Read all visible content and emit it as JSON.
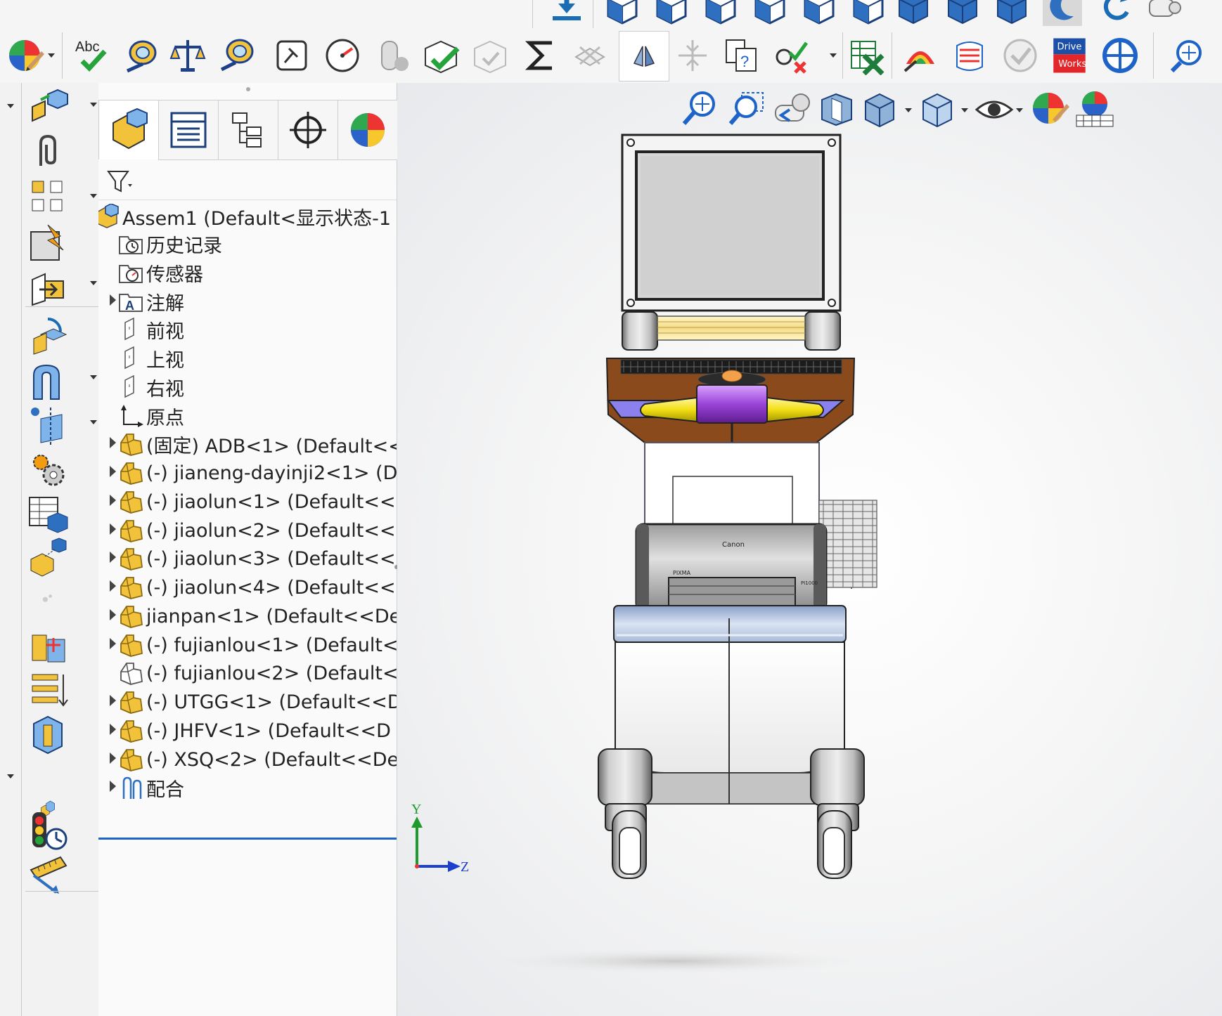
{
  "top_strip": {
    "icons": [
      "insert-component-icon",
      "box-view-icon-1",
      "box-view-icon-2",
      "box-view-icon-3",
      "box-view-icon-4",
      "box-view-icon-5",
      "box-view-icon-6",
      "cube-view-icon-1",
      "cube-view-icon-2",
      "cube-view-icon-3",
      "moon-icon",
      "rotate-icon",
      "camera-icon"
    ]
  },
  "command_bar": {
    "appearance_icon": "appearance-ball-icon",
    "spell_check_label": "Abc",
    "drive_works_line1": "Drive",
    "drive_works_line2": "Works",
    "icons": [
      "spell-check-icon",
      "measure-icon",
      "mass-properties-icon",
      "section-properties-icon",
      "sensor-icon",
      "performance-icon",
      "interference-icon",
      "check-icon",
      "sum-icon",
      "hole-alignment-icon",
      "symmetry-icon",
      "compare-icon",
      "compare-docs-icon",
      "check-errors-icon",
      "excel-x-icon",
      "curvature-icon",
      "zebra-icon",
      "grey-check-icon",
      "driveworks-icon",
      "rotate-view-icon",
      "zoom-fit-icon"
    ]
  },
  "left_toolbar": {
    "icons": [
      "insert-components-icon",
      "mate-icon",
      "linear-pattern-icon",
      "smart-fasteners-icon",
      "move-component-icon",
      "rotate-components-icon",
      "assembly-features-icon",
      "reference-geometry-icon",
      "gear-features-icon",
      "bill-of-materials-icon",
      "exploded-view-icon",
      "explode-line-icon",
      "interference-detection-icon",
      "align-icon",
      "section-view-icon",
      "instant3d-icon",
      "large-assembly-icon",
      "traffic-light-icon",
      "ruler-icon"
    ]
  },
  "feature_manager": {
    "tabs": [
      "feature-manager-tab",
      "property-manager-tab",
      "configuration-manager-tab",
      "dimxpert-tab",
      "display-manager-tab"
    ],
    "filter_icon": "filter-icon",
    "root": "Assem1  (Default<显示状态-1",
    "items": [
      {
        "label": "历史记录",
        "icon": "history-icon",
        "expandable": false
      },
      {
        "label": "传感器",
        "icon": "sensor-folder-icon",
        "expandable": false
      },
      {
        "label": "注解",
        "icon": "annotation-icon",
        "expandable": true
      },
      {
        "label": "前视",
        "icon": "plane-icon",
        "expandable": false
      },
      {
        "label": "上视",
        "icon": "plane-icon",
        "expandable": false
      },
      {
        "label": "右视",
        "icon": "plane-icon",
        "expandable": false
      },
      {
        "label": "原点",
        "icon": "origin-icon",
        "expandable": false
      },
      {
        "label": "(固定) ADB<1> (Default<<",
        "icon": "part-icon",
        "expandable": true
      },
      {
        "label": "(-) jianeng-dayinji2<1> (D",
        "icon": "part-icon",
        "expandable": true
      },
      {
        "label": "(-) jiaolun<1> (Default<<",
        "icon": "part-icon",
        "expandable": true
      },
      {
        "label": "(-) jiaolun<2> (Default<<",
        "icon": "part-icon",
        "expandable": true
      },
      {
        "label": "(-) jiaolun<3> (Default<<",
        "icon": "part-icon",
        "expandable": true
      },
      {
        "label": "(-) jiaolun<4> (Default<<",
        "icon": "part-icon",
        "expandable": true
      },
      {
        "label": "jianpan<1> (Default<<De",
        "icon": "part-icon",
        "expandable": true
      },
      {
        "label": "(-) fujianlou<1> (Default<",
        "icon": "part-icon",
        "expandable": true
      },
      {
        "label": "(-) fujianlou<2> (Default<",
        "icon": "part-outline-icon",
        "expandable": false
      },
      {
        "label": "(-) UTGG<1> (Default<<D",
        "icon": "part-icon",
        "expandable": true
      },
      {
        "label": "(-) JHFV<1> (Default<<D",
        "icon": "part-icon",
        "expandable": true
      },
      {
        "label": "(-) XSQ<2> (Default<<De",
        "icon": "part-icon",
        "expandable": true
      },
      {
        "label": "配合",
        "icon": "mates-icon",
        "expandable": true
      }
    ]
  },
  "viewport": {
    "hud_icons": [
      "zoom-to-fit-icon",
      "zoom-to-area-icon",
      "previous-view-icon",
      "section-view-icon",
      "view-orientation-icon",
      "display-style-icon",
      "hide-show-icon",
      "edit-appearance-icon",
      "scene-icon"
    ],
    "printer_brand": "Canon",
    "printer_model": "PIXMA",
    "printer_code": "PI1000",
    "triad_y": "Y",
    "triad_z": "Z"
  },
  "colors": {
    "accent_blue": "#1e63c8",
    "part_yellow": "#f2c23a",
    "keyboard_brown": "#8a4a1c",
    "handle_purple": "#9b44d8",
    "handle_yellow": "#f5e21a",
    "triad_green": "#1f9a2c",
    "triad_blue": "#1d3fd0"
  }
}
